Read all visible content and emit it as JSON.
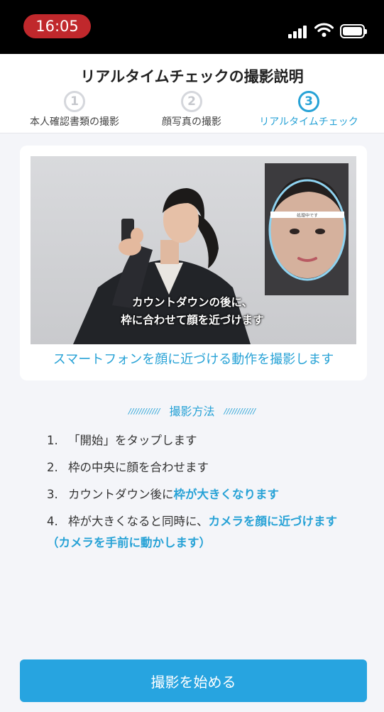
{
  "status_bar": {
    "time": "16:05"
  },
  "header": {
    "title": "リアルタイムチェックの撮影説明",
    "steps": [
      {
        "number": "1",
        "label": "本人確認書類の撮影"
      },
      {
        "number": "2",
        "label": "顔写真の撮影"
      },
      {
        "number": "3",
        "label": "リアルタイムチェック"
      }
    ],
    "active_step": 3
  },
  "image_card": {
    "overlay_caption_line1": "カウントダウンの後に、",
    "overlay_caption_line2": "枠に合わせて顔を近づけます",
    "inset_label": "処理中です",
    "caption": "スマートフォンを顔に近づける動作を撮影します"
  },
  "instructions": {
    "heading_deco": "////////////",
    "heading": "撮影方法",
    "items": [
      {
        "number": "1.",
        "text": "「開始」をタップします"
      },
      {
        "number": "2.",
        "text": "枠の中央に顔を合わせます"
      },
      {
        "number": "3.",
        "text": "カウントダウン後に",
        "highlight": "枠が大きくなります"
      },
      {
        "number": "4.",
        "text": "枠が大きくなると同時に、",
        "highlight": "カメラを顔に近づけます（カメラを手前に動かします）"
      }
    ]
  },
  "start_button": {
    "label": "撮影を始める"
  },
  "colors": {
    "accent": "#27a2d6",
    "button": "#27a4e0",
    "time_pill": "#c0282c"
  }
}
